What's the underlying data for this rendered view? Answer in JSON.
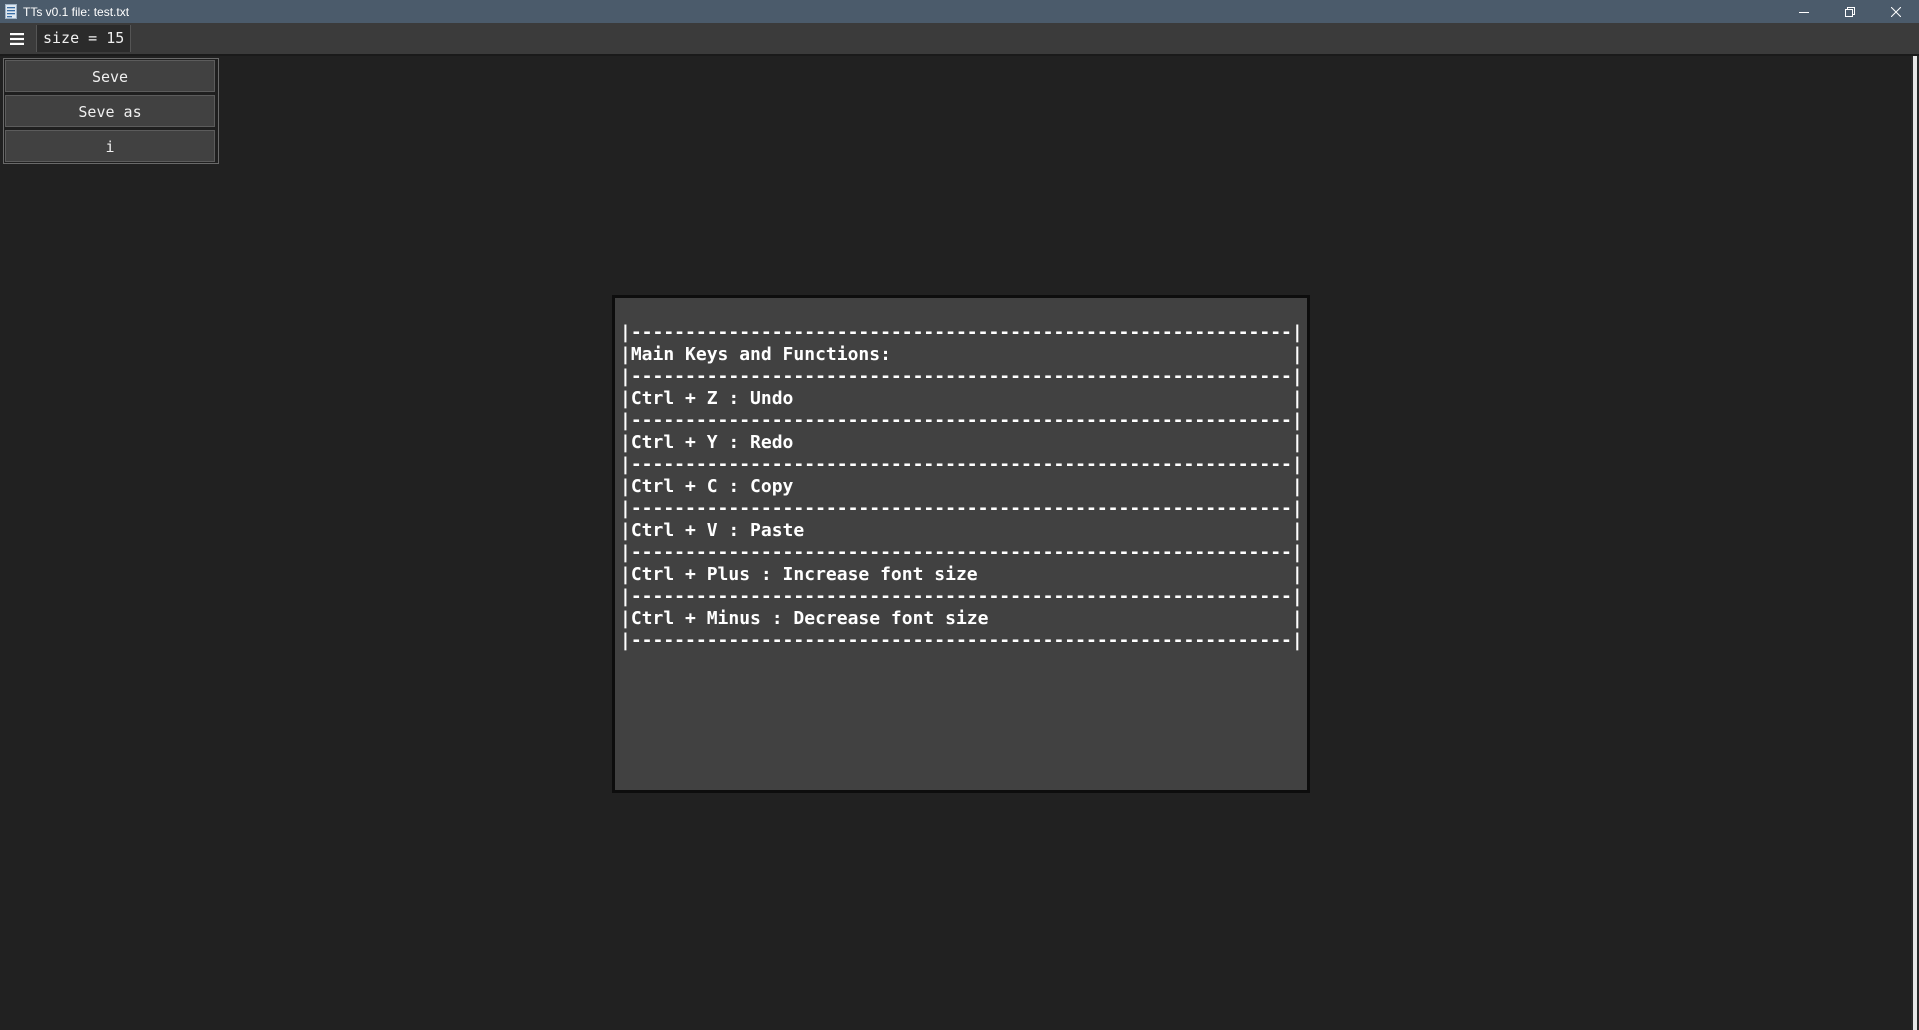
{
  "window": {
    "title": "TTs v0.1 file: test.txt",
    "icons": {
      "app": "text-file-icon",
      "minimize": "minimize-icon",
      "maximize": "restore-icon",
      "close": "close-icon"
    }
  },
  "toolbar": {
    "menu_icon": "hamburger-menu-icon",
    "size_label": "size = 15"
  },
  "side_menu": {
    "items": [
      {
        "label": "Seve"
      },
      {
        "label": "Seve as"
      },
      {
        "label": "i"
      }
    ]
  },
  "info": {
    "lines": [
      "|-------------------------------------------------------------|",
      "|Main Keys and Functions:                                     |",
      "|-------------------------------------------------------------|",
      "|Ctrl + Z : Undo                                              |",
      "|-------------------------------------------------------------|",
      "|Ctrl + Y : Redo                                              |",
      "|-------------------------------------------------------------|",
      "|Ctrl + C : Copy                                              |",
      "|-------------------------------------------------------------|",
      "|Ctrl + V : Paste                                             |",
      "|-------------------------------------------------------------|",
      "|Ctrl + Plus : Increase font size                             |",
      "|-------------------------------------------------------------|",
      "|Ctrl + Minus : Decrease font size                            |",
      "|-------------------------------------------------------------|"
    ]
  },
  "colors": {
    "background": "#212121",
    "titlebar": "#4b5b6b",
    "toolbar": "#3b3b3b",
    "panel": "#414141",
    "text": "#ffffff"
  }
}
